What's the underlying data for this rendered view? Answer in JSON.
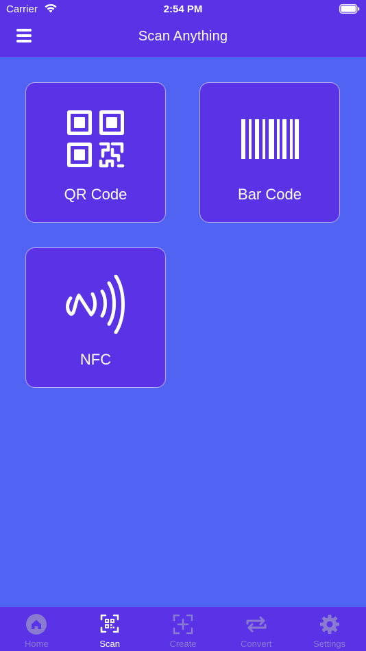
{
  "status_bar": {
    "carrier": "Carrier",
    "time": "2:54 PM"
  },
  "nav": {
    "title": "Scan Anything",
    "menu_icon": "hamburger-menu-icon"
  },
  "options": [
    {
      "label": "QR Code",
      "icon": "qr-code-icon"
    },
    {
      "label": "Bar Code",
      "icon": "barcode-icon"
    },
    {
      "label": "NFC",
      "icon": "nfc-icon"
    }
  ],
  "tabs": [
    {
      "label": "Home",
      "icon": "home-icon",
      "active": false
    },
    {
      "label": "Scan",
      "icon": "scan-qr-icon",
      "active": true
    },
    {
      "label": "Create",
      "icon": "create-plus-icon",
      "active": false
    },
    {
      "label": "Convert",
      "icon": "convert-arrows-icon",
      "active": false
    },
    {
      "label": "Settings",
      "icon": "gear-icon",
      "active": false
    }
  ],
  "colors": {
    "background": "#5063f3",
    "bar": "#5a33e6",
    "card": "#5a33e6",
    "card_border": "#b8abf4",
    "tab_inactive": "#8a7bd1",
    "tab_active": "#ffffff"
  }
}
